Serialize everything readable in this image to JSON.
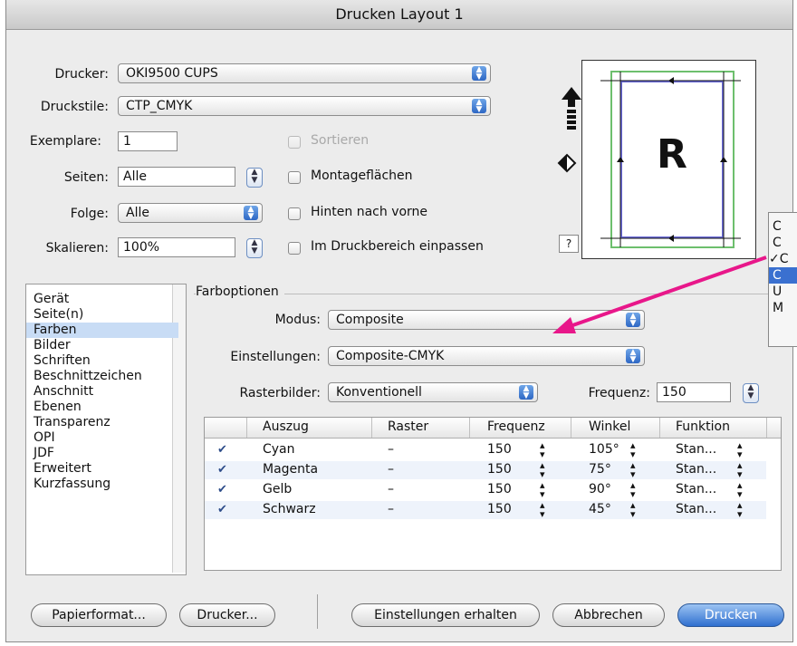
{
  "window": {
    "title": "Drucken Layout 1"
  },
  "top": {
    "drucker_label": "Drucker:",
    "drucker_value": "OKI9500 CUPS",
    "druckstile_label": "Druckstile:",
    "druckstile_value": "CTP_CMYK",
    "exemplare_label": "Exemplare:",
    "exemplare_value": "1",
    "sortieren_label": "Sortieren",
    "seiten_label": "Seiten:",
    "seiten_value": "Alle",
    "montage_label": "Montageflächen",
    "folge_label": "Folge:",
    "folge_value": "Alle",
    "hinten_label": "Hinten nach vorne",
    "skalieren_label": "Skalieren:",
    "skalieren_value": "100%",
    "einpassen_label": "Im Druckbereich einpassen"
  },
  "preview": {
    "letter": "R",
    "help": "?"
  },
  "sidebar": {
    "items": [
      "Gerät",
      "Seite(n)",
      "Farben",
      "Bilder",
      "Schriften",
      "Beschnittzeichen",
      "Anschnitt",
      "Ebenen",
      "Transparenz",
      "OPI",
      "JDF",
      "Erweitert",
      "Kurzfassung"
    ],
    "selected": "Farben"
  },
  "farboptionen": {
    "heading": "Farboptionen",
    "modus_label": "Modus:",
    "modus_value": "Composite",
    "einstellungen_label": "Einstellungen:",
    "einstellungen_value": "Composite-CMYK",
    "raster_label": "Rasterbilder:",
    "raster_value": "Konventionell",
    "frequenz_label": "Frequenz:",
    "frequenz_value": "150"
  },
  "table": {
    "headers": [
      "Auszug",
      "Raster",
      "Frequenz",
      "Winkel",
      "Funktion"
    ],
    "rows": [
      {
        "check": "✔",
        "auszug": "Cyan",
        "raster": "–",
        "frequenz": "150",
        "winkel": "105°",
        "funktion": "Stan..."
      },
      {
        "check": "✔",
        "auszug": "Magenta",
        "raster": "–",
        "frequenz": "150",
        "winkel": "75°",
        "funktion": "Stan..."
      },
      {
        "check": "✔",
        "auszug": "Gelb",
        "raster": "–",
        "frequenz": "150",
        "winkel": "90°",
        "funktion": "Stan..."
      },
      {
        "check": "✔",
        "auszug": "Schwarz",
        "raster": "–",
        "frequenz": "150",
        "winkel": "45°",
        "funktion": "Stan..."
      }
    ]
  },
  "popup_menu": {
    "items": [
      "C",
      "C",
      "C",
      "C",
      "U",
      "M"
    ],
    "checked_mark": "✓"
  },
  "buttons": {
    "papierformat": "Papierformat...",
    "drucker": "Drucker...",
    "einstellungen": "Einstellungen erhalten",
    "abbrechen": "Abbrechen",
    "drucken": "Drucken"
  },
  "colors": {
    "arrow": "#e8178a",
    "accent": "#2f6fcf",
    "selection": "#c8dcf5"
  }
}
